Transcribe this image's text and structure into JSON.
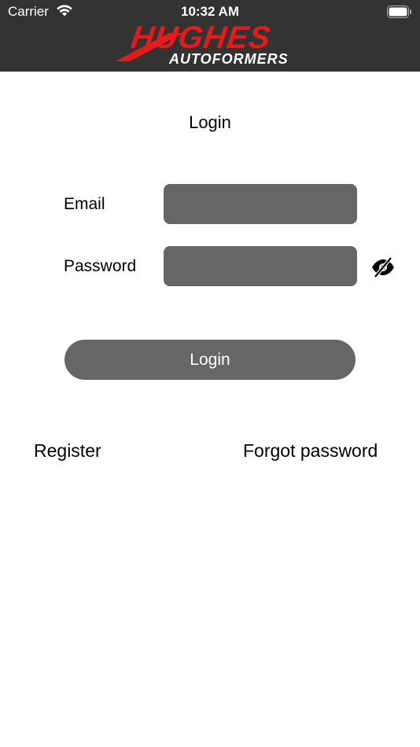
{
  "status_bar": {
    "carrier": "Carrier",
    "time": "10:32 AM",
    "wifi_icon": "wifi-icon",
    "battery_icon": "battery-icon"
  },
  "header": {
    "logo_main": "HUGHES",
    "logo_sub": "AUTOFORMERS",
    "background_color": "#333333",
    "brand_red": "#e31b1b"
  },
  "page": {
    "title": "Login"
  },
  "form": {
    "email_label": "Email",
    "email_value": "",
    "password_label": "Password",
    "password_value": "",
    "toggle_icon": "eye-slash-icon",
    "field_color": "#666666"
  },
  "actions": {
    "login_label": "Login",
    "register_label": "Register",
    "forgot_label": "Forgot password"
  }
}
